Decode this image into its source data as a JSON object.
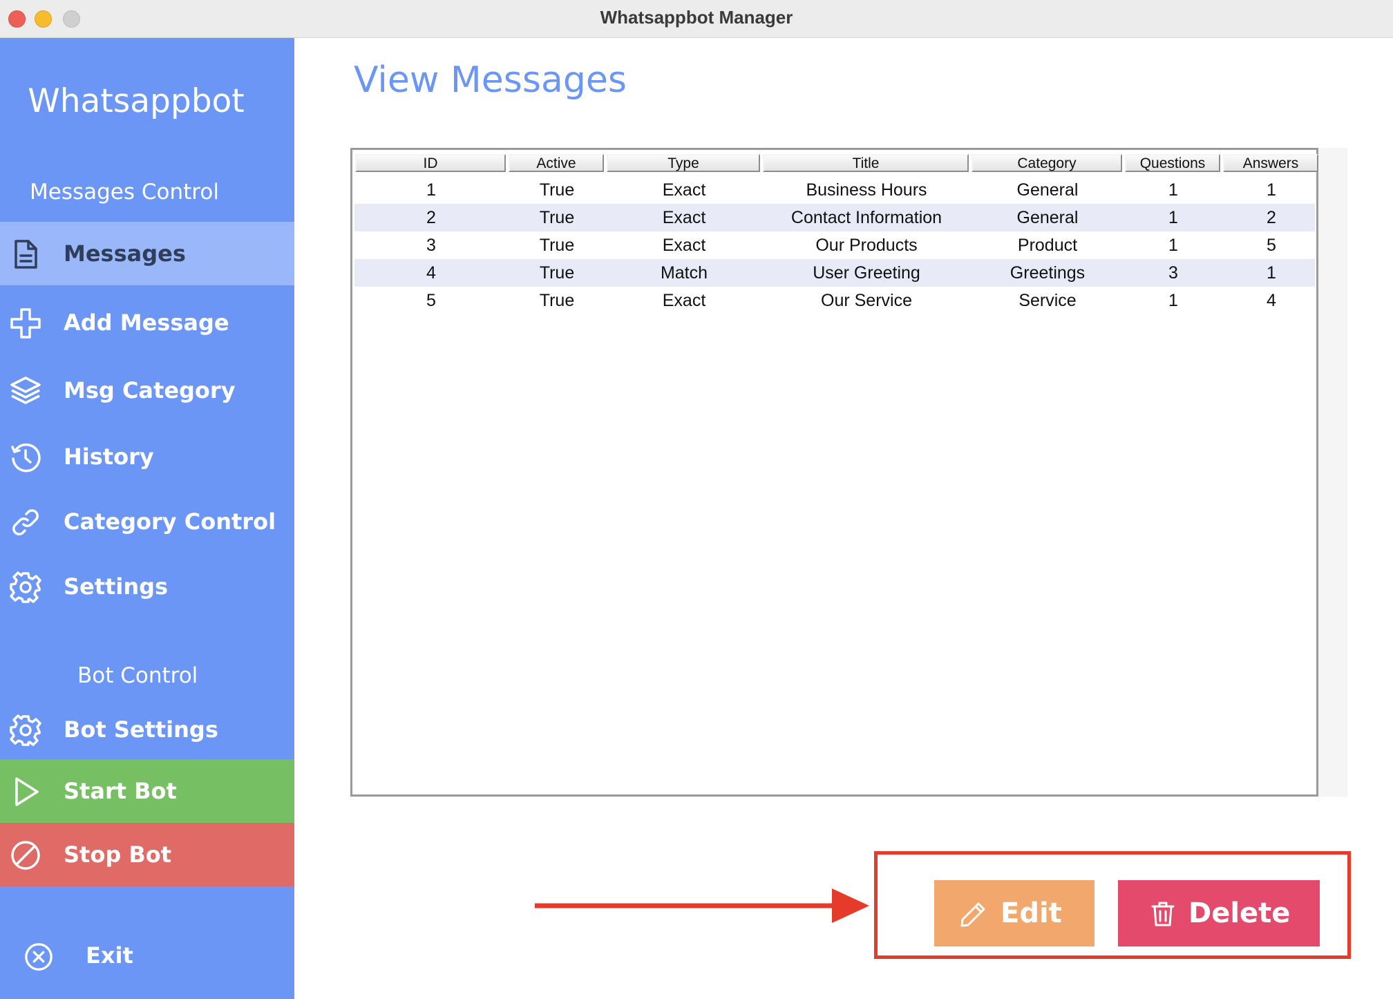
{
  "window": {
    "title": "Whatsappbot Manager"
  },
  "sidebar": {
    "brand": "Whatsappbot",
    "messages_section": "Messages Control",
    "bot_section": "Bot Control",
    "items": [
      {
        "label": "Messages",
        "icon": "document-icon",
        "active": true
      },
      {
        "label": "Add Message",
        "icon": "plus-icon"
      },
      {
        "label": "Msg Category",
        "icon": "layers-icon"
      },
      {
        "label": "History",
        "icon": "history-icon"
      },
      {
        "label": "Category Control",
        "icon": "link-icon"
      },
      {
        "label": "Settings",
        "icon": "gear-icon"
      }
    ],
    "bot_items": [
      {
        "label": "Bot Settings",
        "icon": "gear-icon"
      },
      {
        "label": "Start Bot",
        "icon": "play-icon"
      },
      {
        "label": "Stop Bot",
        "icon": "stop-icon"
      }
    ],
    "exit_label": "Exit"
  },
  "main": {
    "title": "View Messages",
    "table": {
      "columns": [
        "ID",
        "Active",
        "Type",
        "Title",
        "Category",
        "Questions",
        "Answers"
      ],
      "rows": [
        [
          "1",
          "True",
          "Exact",
          "Business Hours",
          "General",
          "1",
          "1"
        ],
        [
          "2",
          "True",
          "Exact",
          "Contact Information",
          "General",
          "1",
          "2"
        ],
        [
          "3",
          "True",
          "Exact",
          "Our Products",
          "Product",
          "1",
          "5"
        ],
        [
          "4",
          "True",
          "Match",
          "User Greeting",
          "Greetings",
          "3",
          "1"
        ],
        [
          "5",
          "True",
          "Exact",
          "Our Service",
          "Service",
          "1",
          "4"
        ]
      ]
    },
    "edit_label": "Edit",
    "delete_label": "Delete"
  },
  "colors": {
    "sidebar": "#6b96f6",
    "active_item": "#9ab7fa",
    "start": "#76bf63",
    "stop": "#e06a66",
    "edit": "#f2a86c",
    "delete": "#e34a6b",
    "annotation": "#e53b2b"
  }
}
